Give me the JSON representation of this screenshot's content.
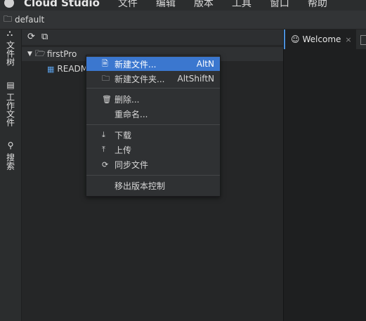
{
  "menubar": {
    "app_name": "Cloud Studio",
    "items": [
      "文件",
      "编辑",
      "版本",
      "工具",
      "窗口",
      "帮助"
    ]
  },
  "project": {
    "name": "default",
    "icon": "folder-icon"
  },
  "activity_bar": {
    "tabs": [
      {
        "label": "文件树",
        "icon": "tree-icon"
      },
      {
        "label": "工作文件",
        "icon": "file-icon"
      },
      {
        "label": "搜索",
        "icon": "search-icon"
      }
    ]
  },
  "explorer": {
    "toolbar": [
      "refresh-icon",
      "collapse-icon"
    ],
    "root": {
      "label": "firstPro",
      "icon": "folder-open-icon"
    },
    "children": [
      {
        "label": "READM",
        "icon": "markdown-icon"
      }
    ]
  },
  "editor": {
    "tabs": [
      {
        "label": "Welcome",
        "icon": "smiley-icon",
        "close": "×"
      }
    ]
  },
  "context_menu": {
    "items": [
      {
        "icon": "file-icon",
        "label": "新建文件...",
        "shortcut": "AltN",
        "selected": true
      },
      {
        "icon": "folder-icon",
        "label": "新建文件夹...",
        "shortcut": "AltShiftN"
      },
      {
        "icon": "trash-icon",
        "label": "删除..."
      },
      {
        "icon": "",
        "label": "重命名..."
      },
      {
        "icon": "download-icon",
        "label": "下载"
      },
      {
        "icon": "upload-icon",
        "label": "上传"
      },
      {
        "icon": "sync-icon",
        "label": "同步文件"
      },
      {
        "icon": "",
        "label": "移出版本控制"
      }
    ]
  },
  "colors": {
    "accent": "#3b77cf",
    "tab_border": "#4b8fd9",
    "markdown": "#5aa0e8"
  }
}
